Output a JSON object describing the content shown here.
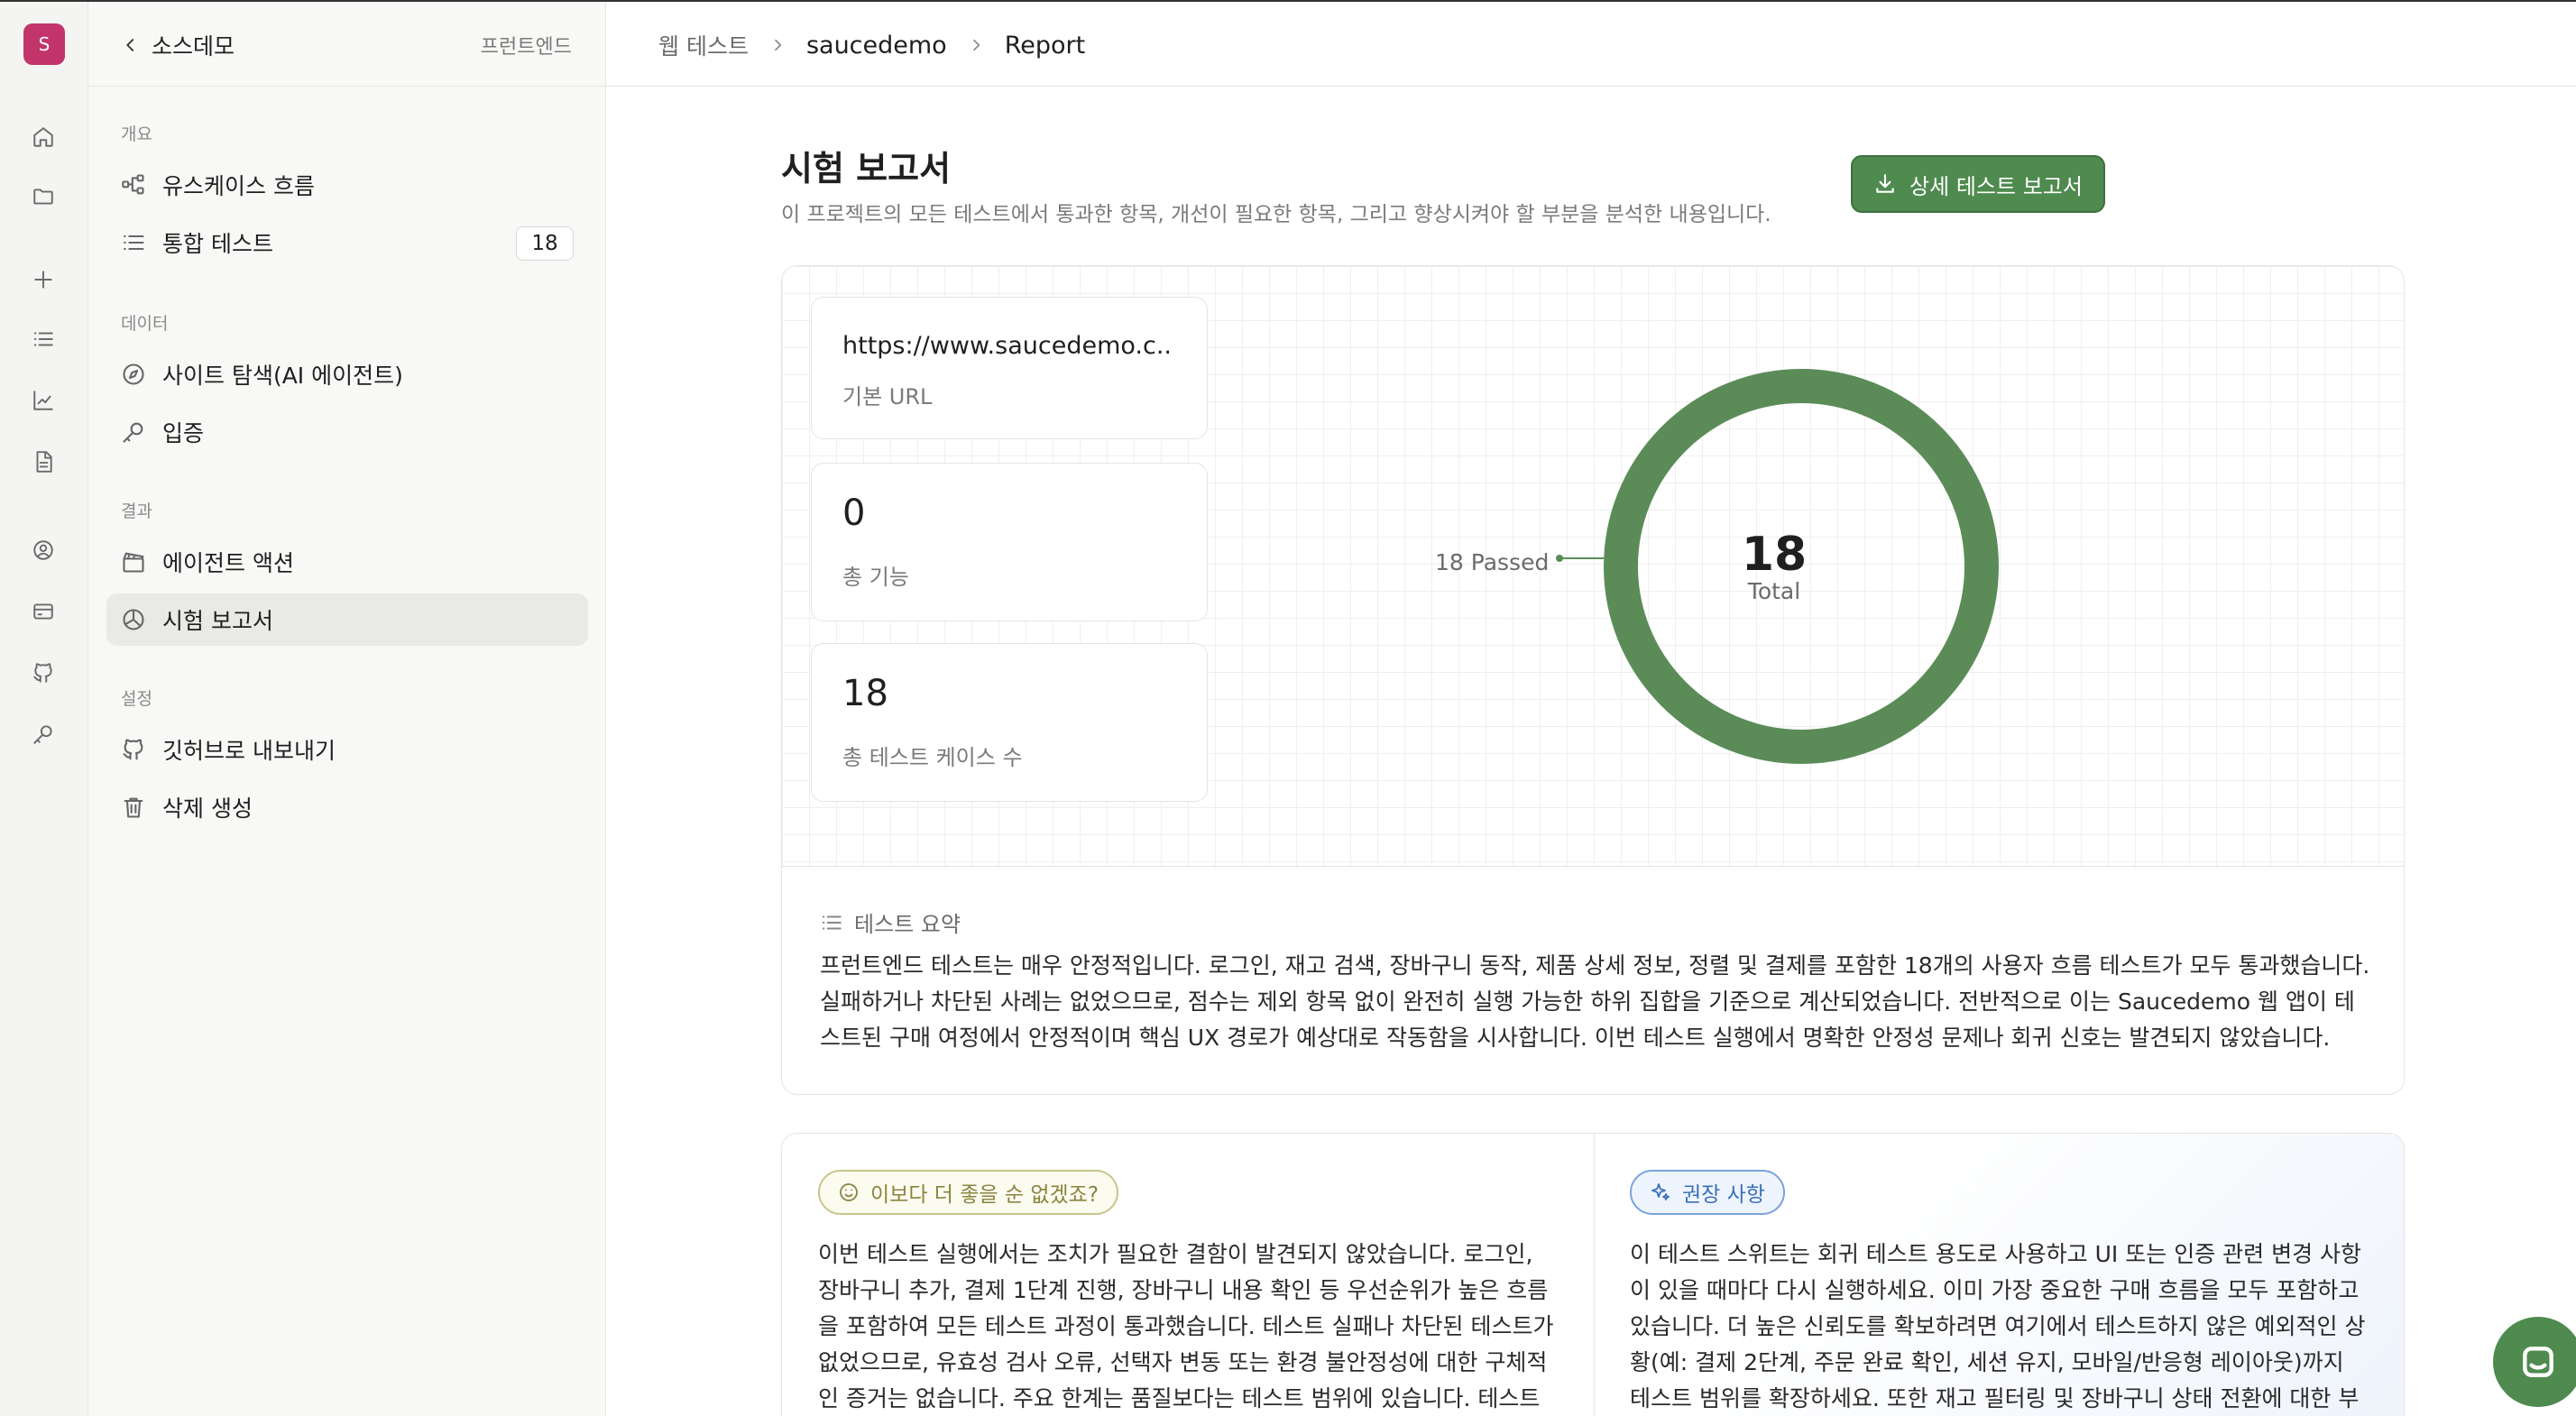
{
  "app": {
    "logo_letter": "S"
  },
  "sidebar": {
    "project_name": "소스데모",
    "project_tag": "프런트엔드",
    "sections": {
      "overview": "개요",
      "data": "데이터",
      "results": "결과",
      "settings": "설정"
    },
    "items": [
      {
        "label": "유스케이스 흐름",
        "icon": "flow-icon"
      },
      {
        "label": "통합 테스트",
        "icon": "list-icon",
        "badge": "18"
      },
      {
        "label": "사이트 탐색(AI 에이전트)",
        "icon": "compass-icon"
      },
      {
        "label": "입증",
        "icon": "key-icon"
      },
      {
        "label": "에이전트 액션",
        "icon": "clapper-icon"
      },
      {
        "label": "시험 보고서",
        "icon": "chart-pie-icon",
        "active": true
      },
      {
        "label": "깃허브로 내보내기",
        "icon": "github-icon"
      },
      {
        "label": "삭제 생성",
        "icon": "trash-icon"
      }
    ]
  },
  "breadcrumb": {
    "root": "웹 테스트",
    "project": "saucedemo",
    "page": "Report"
  },
  "page": {
    "title": "시험 보고서",
    "subtitle": "이 프로젝트의 모든 테스트에서 통과한 항목, 개선이 필요한 항목, 그리고 향상시켜야 할 부분을 분석한 내용입니다.",
    "download_button": "상세 테스트 보고서"
  },
  "stats": [
    {
      "value": "https://www.saucedemo.c..",
      "label": "기본 URL"
    },
    {
      "value": "0",
      "label": "총 기능"
    },
    {
      "value": "18",
      "label": "총 테스트 케이스 수"
    }
  ],
  "chart_data": {
    "type": "pie",
    "categories": [
      "Passed"
    ],
    "values": [
      18
    ],
    "center_value": "18",
    "center_label": "Total",
    "slice_labels": [
      "18 Passed"
    ],
    "colors": {
      "passed": "#5b8c58"
    }
  },
  "summary": {
    "heading": "테스트 요약",
    "text": "프런트엔드 테스트는 매우 안정적입니다. 로그인, 재고 검색, 장바구니 동작, 제품 상세 정보, 정렬 및 결제를 포함한 18개의 사용자 흐름 테스트가 모두 통과했습니다. 실패하거나 차단된 사례는 없었으므로, 점수는 제외 항목 없이 완전히 실행 가능한 하위 집합을 기준으로 계산되었습니다. 전반적으로 이는 Saucedemo 웹 앱이 테스트된 구매 여정에서 안정적이며 핵심 UX 경로가 예상대로 작동함을 시사합니다. 이번 테스트 실행에서 명확한 안정성 문제나 회귀 신호는 발견되지 않았습니다."
  },
  "improve": {
    "label": "이보다 더 좋을 순 없겠죠?",
    "text": "이번 테스트 실행에서는 조치가 필요한 결함이 발견되지 않았습니다. 로그인, 장바구니 추가, 결제 1단계 진행, 장바구니 내용 확인 등 우선순위가 높은 흐름을 포함하여 모든 테스트 과정이 통과했습니다. 테스트 실패나 차단된 테스트가 없었으므로, 유효성 검사 오류, 선택자 변동 또는 환경 불안정성에 대한 구체적인 증거는 없습니다. 주요 한계는 품질보다는 테스트 범위에 있습니다. 테스트 스위트는 예"
  },
  "recommend": {
    "label": "권장 사항",
    "text": "이 테스트 스위트는 회귀 테스트 용도로 사용하고 UI 또는 인증 관련 변경 사항이 있을 때마다 다시 실행하세요. 이미 가장 중요한 구매 흐름을 모두 포함하고 있습니다. 더 높은 신뢰도를 확보하려면 여기에서 테스트하지 않은 예외적인 상황(예: 결제 2단계, 주문 완료 확인, 세션 유지, 모바일/반응형 레이아웃)까지 테스트 범위를 확장하세요. 또한 재고 필터링 및 장바구니 상태 전환에 대한 부정 경로 검증"
  }
}
